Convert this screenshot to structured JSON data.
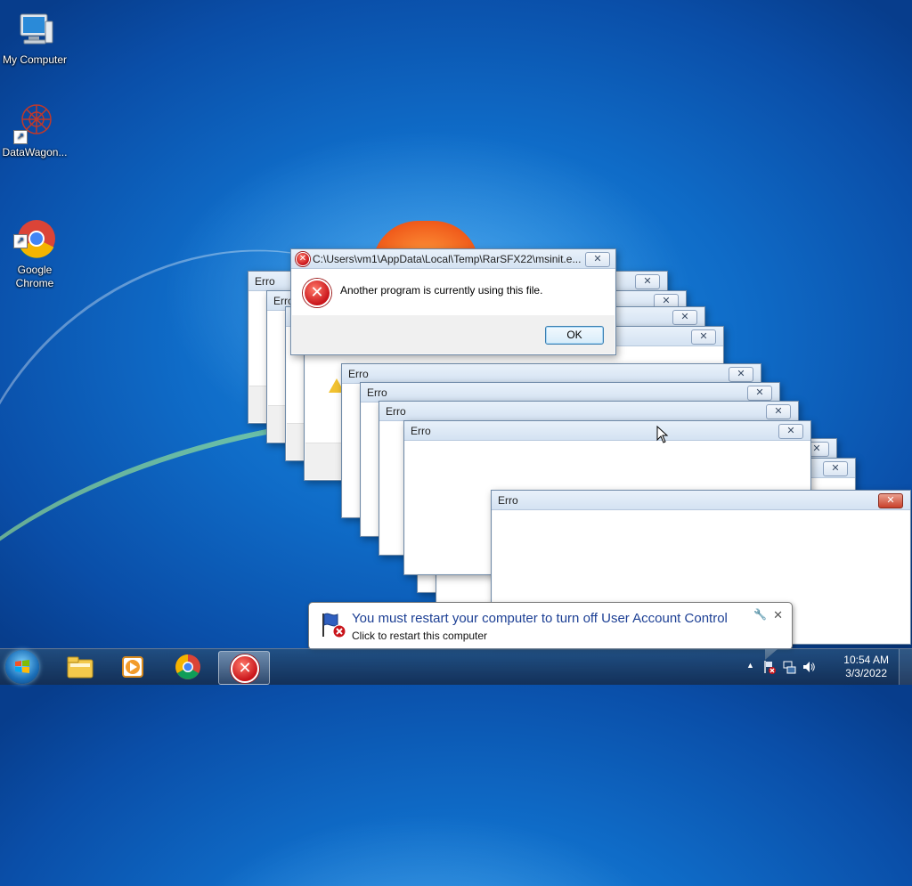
{
  "desktop": {
    "icons": [
      {
        "label": "My Computer",
        "icon": "computer-icon"
      },
      {
        "label": "DataWagon...",
        "icon": "datawagon-icon"
      },
      {
        "label": "Google\nChrome",
        "icon": "chrome-icon"
      }
    ]
  },
  "error_windows": {
    "title": "Erro",
    "close_glyph": "✕"
  },
  "main_dialog": {
    "title": "C:\\Users\\vm1\\AppData\\Local\\Temp\\RarSFX22\\msinit.e...",
    "message": "Another program is currently using this file.",
    "ok_label": "OK",
    "close_glyph": "✕",
    "icon": "error-icon"
  },
  "balloon": {
    "title": "You must restart your computer to turn off User Account Control",
    "text": "Click to restart this computer",
    "close_glyph": "✕",
    "options_glyph": "🔧"
  },
  "taskbar": {
    "pinned": [
      "explorer-icon",
      "media-player-icon",
      "chrome-icon",
      "error-app-icon"
    ],
    "tray": {
      "time": "10:54 AM",
      "date": "3/3/2022",
      "arrow": "▲"
    }
  },
  "colors": {
    "accent": "#0f6cc8",
    "error_red": "#c9141a",
    "balloon_title": "#1c3f94"
  }
}
